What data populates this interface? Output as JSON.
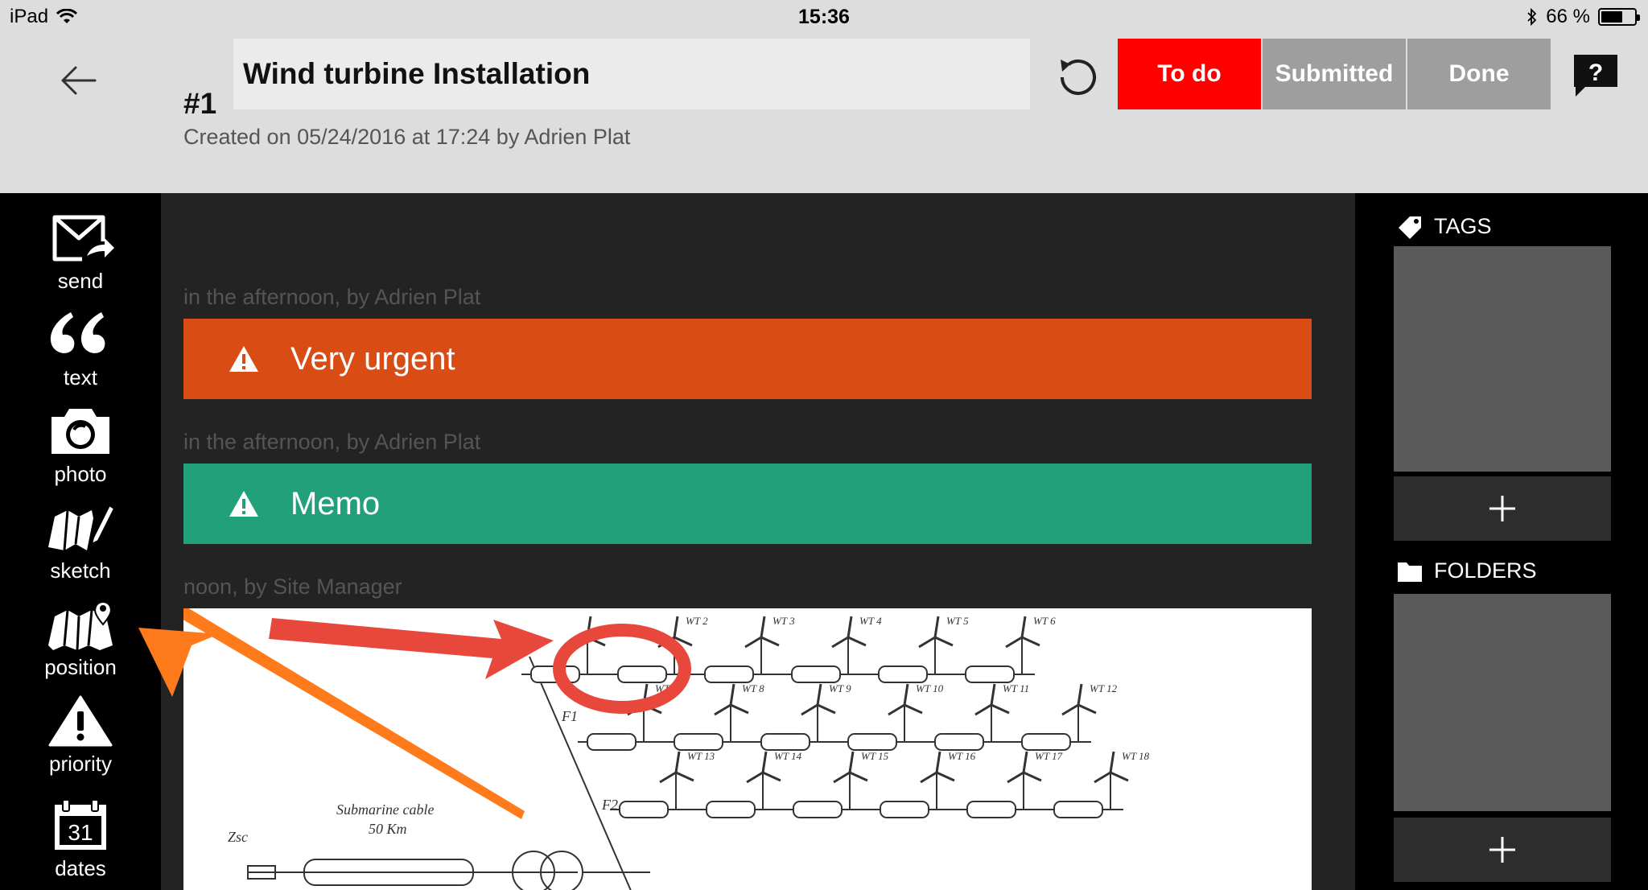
{
  "status_bar": {
    "device": "iPad",
    "time": "15:36",
    "battery_text": "66 %",
    "battery_level": 0.66
  },
  "header": {
    "task_number": "#1",
    "title": "Wind turbine Installation",
    "created": "Created on 05/24/2016 at 17:24 by Adrien Plat",
    "status_buttons": [
      {
        "label": "To do",
        "active": true
      },
      {
        "label": "Submitted",
        "active": false
      },
      {
        "label": "Done",
        "active": false
      }
    ],
    "help_glyph": "?"
  },
  "toolbar": {
    "items": [
      {
        "label": "send",
        "icon": "envelope-send-icon"
      },
      {
        "label": "text",
        "icon": "quote-icon"
      },
      {
        "label": "photo",
        "icon": "camera-icon"
      },
      {
        "label": "sketch",
        "icon": "map-pencil-icon"
      },
      {
        "label": "position",
        "icon": "map-pin-icon"
      },
      {
        "label": "priority",
        "icon": "warning-icon"
      },
      {
        "label": "dates",
        "icon": "calendar-icon"
      }
    ],
    "calendar_day": "31"
  },
  "feed": {
    "entries": [
      {
        "meta": "in the afternoon, by Adrien Plat",
        "text": "Very urgent",
        "color": "#d94c13"
      },
      {
        "meta": "in the afternoon, by Adrien Plat",
        "text": "Memo",
        "color": "#21a07a"
      },
      {
        "meta": "noon, by Site Manager"
      }
    ],
    "diagram": {
      "feeders": [
        "F1",
        "F2"
      ],
      "row1": [
        "WT 2",
        "WT 3",
        "WT 4",
        "WT 5",
        "WT 6"
      ],
      "row2": [
        "WT 7",
        "WT 8",
        "WT 9",
        "WT 10",
        "WT 11",
        "WT 12"
      ],
      "row3": [
        "WT 13",
        "WT 14",
        "WT 15",
        "WT 16",
        "WT 17",
        "WT 18"
      ],
      "cable_label": "Submarine cable",
      "cable_length": "50 Km",
      "zsc": "Zsc"
    }
  },
  "sidebar": {
    "tags_title": "TAGS",
    "folders_title": "FOLDERS"
  },
  "colors": {
    "header_bg": "#dddddd",
    "todo_red": "#ff0000",
    "inactive_gray": "#9e9e9e",
    "urgent_orange": "#d94c13",
    "memo_green": "#21a07a",
    "annotation_red": "#e8473b",
    "annotation_orange": "#ff7a1a"
  }
}
